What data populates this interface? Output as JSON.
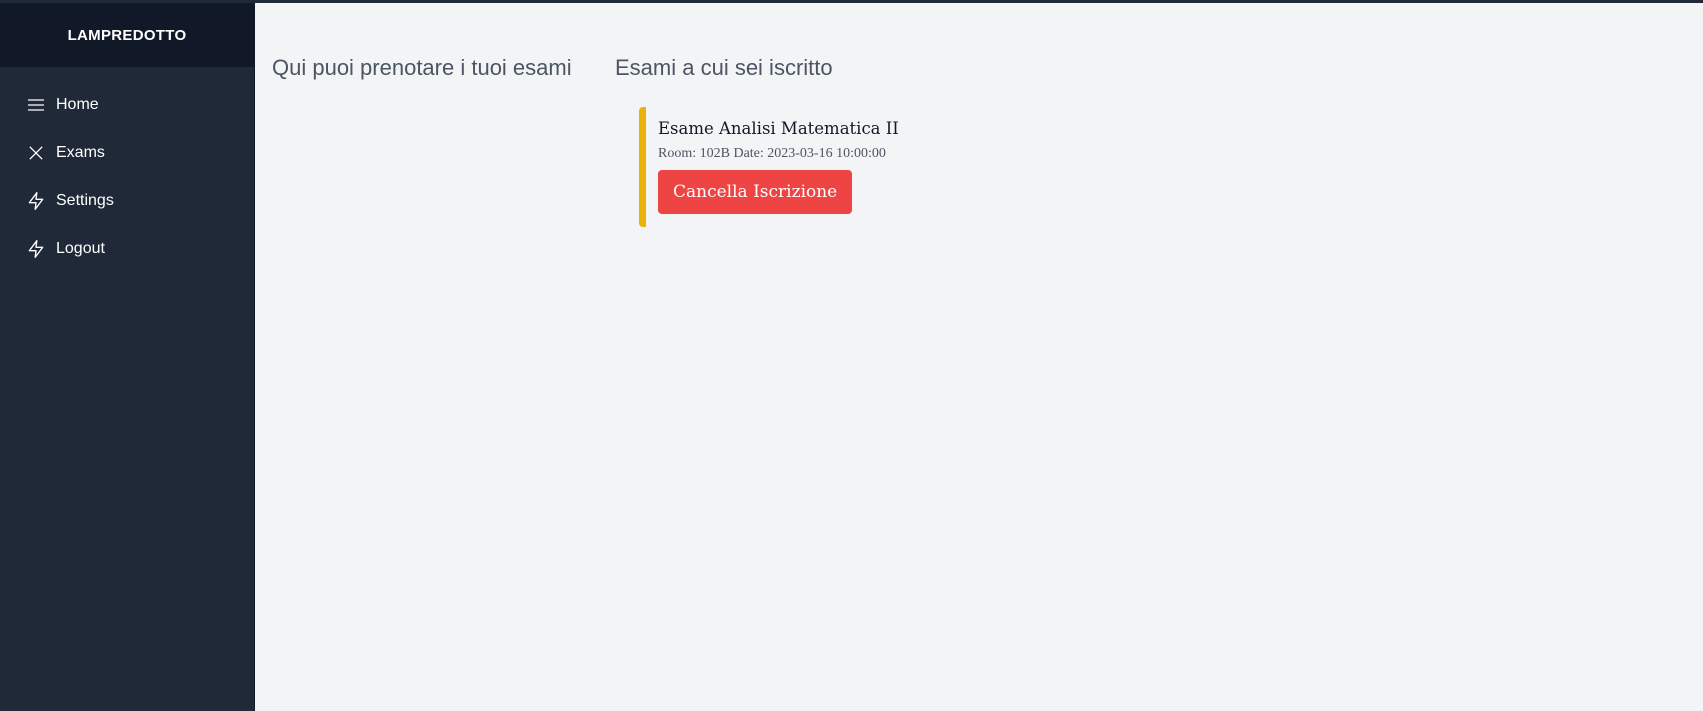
{
  "sidebar": {
    "brand": "LAMPREDOTTO",
    "items": [
      {
        "label": "Home",
        "icon": "menu-icon"
      },
      {
        "label": "Exams",
        "icon": "close-icon"
      },
      {
        "label": "Settings",
        "icon": "lightning-icon"
      },
      {
        "label": "Logout",
        "icon": "lightning-icon"
      }
    ]
  },
  "main": {
    "booking_heading": "Qui puoi prenotare i tuoi esami",
    "enrolled_heading": "Esami a cui sei iscritto",
    "enrolled_exams": [
      {
        "title": "Esame Analisi Matematica II",
        "meta": "Room: 102B Date: 2023-03-16 10:00:00",
        "cancel_label": "Cancella Iscrizione"
      }
    ]
  },
  "colors": {
    "sidebar_bg": "#1f2937",
    "brand_bg": "#111827",
    "page_bg": "#f3f4f6",
    "accent_bar": "#eab308",
    "danger": "#ef4444"
  }
}
